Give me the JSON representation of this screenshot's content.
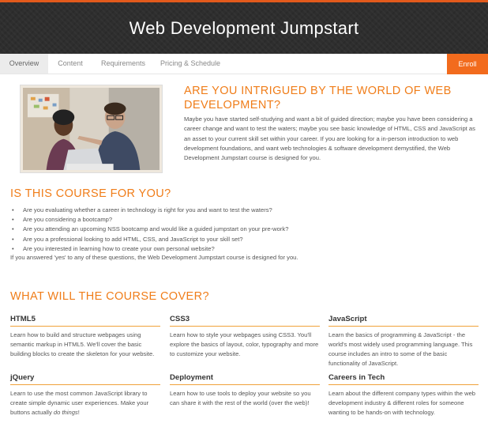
{
  "header": {
    "title": "Web Development Jumpstart"
  },
  "tabs": {
    "overview": "Overview",
    "content": "Content",
    "requirements": "Requirements",
    "pricing": "Pricing & Schedule",
    "enroll": "Enroll"
  },
  "intro": {
    "title": "ARE YOU INTRIGUED BY THE WORLD OF WEB DEVELOPMENT?",
    "body": "Maybe you have started self-studying and want a bit of guided direction; maybe you have been considering a career change and want to test the waters; maybe you see basic knowledge of HTML, CSS and JavaScript as an asset to your current skill set within your career. If you are looking for a in-person introduction to web development foundations, and want web technologies & software development demystified, the Web Development Jumpstart course is designed for you."
  },
  "questions": {
    "title": "IS THIS COURSE FOR YOU?",
    "items": [
      "Are you evaluating whether a career in technology is right for you and want to test the waters?",
      "Are you considering a bootcamp?",
      "Are you attending an upcoming NSS bootcamp and would like a guided jumpstart on your pre-work?",
      "Are you a professional looking to add HTML, CSS, and JavaScript to your skill set?",
      "Are you interested in learning how to create your own personal website?"
    ],
    "answer": "If you answered 'yes' to any of these questions, the Web Development Jumpstart course is designed for you."
  },
  "cover": {
    "title": "WHAT WILL THE COURSE COVER?",
    "cards": [
      {
        "title": "HTML5",
        "text": "Learn how to build and structure webpages using semantic markup in HTML5. We'll cover the basic building blocks to create the skeleton for your website."
      },
      {
        "title": "CSS3",
        "text": "Learn how to style your webpages using CSS3. You'll explore the basics of layout, color, typography and more to customize your website."
      },
      {
        "title": "JavaScript",
        "text": "Learn the basics of programming & JavaScript - the world's most widely used programming language. This course includes an intro to some of the basic functionality of JavaScript."
      },
      {
        "title": "jQuery",
        "text_before": "Learn to use the most common JavaScript library to create simple dynamic user experiences. Make your buttons actually ",
        "text_emphasis": "do things",
        "text_after": "!"
      },
      {
        "title": "Deployment",
        "text": "Learn how to use tools to deploy your website so you can share it with the rest of the world (over the web)!"
      },
      {
        "title": "Careers in Tech",
        "text": "Learn about the different company types within the web development industry & different roles for someone wanting to be hands-on with technology."
      }
    ]
  },
  "colors": {
    "accent": "#f07d19",
    "enroll": "#f26b1d",
    "header_bg": "#2e2e2e"
  }
}
